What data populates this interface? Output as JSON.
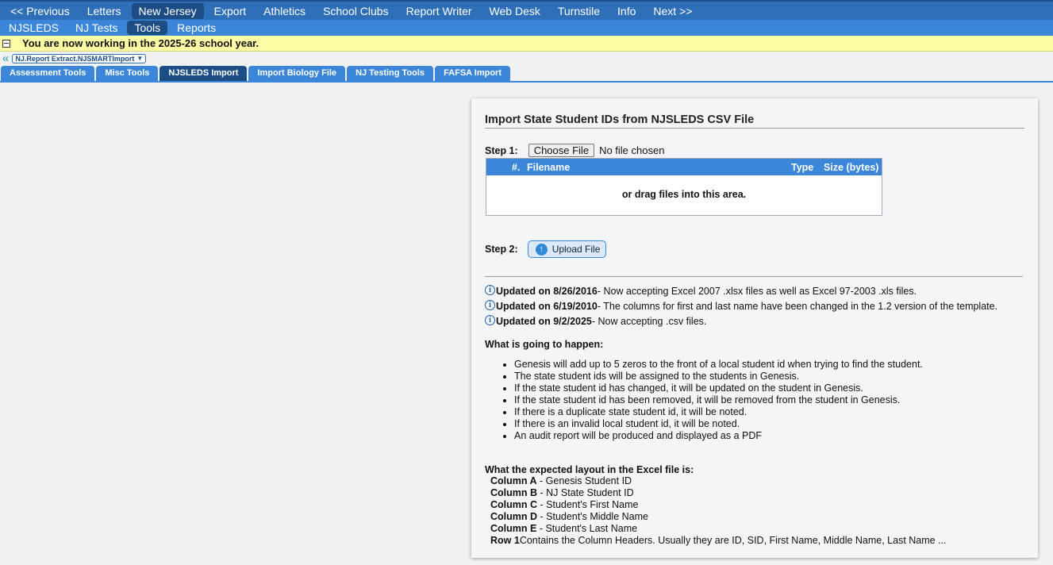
{
  "nav": {
    "items": [
      {
        "label": "<< Previous",
        "active": false
      },
      {
        "label": "Letters",
        "active": false
      },
      {
        "label": "New Jersey",
        "active": true
      },
      {
        "label": "Export",
        "active": false
      },
      {
        "label": "Athletics",
        "active": false
      },
      {
        "label": "School Clubs",
        "active": false
      },
      {
        "label": "Report Writer",
        "active": false
      },
      {
        "label": "Web Desk",
        "active": false
      },
      {
        "label": "Turnstile",
        "active": false
      },
      {
        "label": "Info",
        "active": false
      },
      {
        "label": "Next >>",
        "active": false
      }
    ]
  },
  "subnav": {
    "items": [
      {
        "label": "NJSLEDS",
        "active": false
      },
      {
        "label": "NJ Tests",
        "active": false
      },
      {
        "label": "Tools",
        "active": true
      },
      {
        "label": "Reports",
        "active": false
      }
    ]
  },
  "banner": {
    "text": "You are now working in the 2025-26 school year."
  },
  "breadcrumb": {
    "select_value": "NJ.Report Extract.NJSMARTImport"
  },
  "tabs": [
    {
      "label": "Assessment Tools",
      "active": false
    },
    {
      "label": "Misc Tools",
      "active": false
    },
    {
      "label": "NJSLEDS Import",
      "active": true
    },
    {
      "label": "Import Biology File",
      "active": false
    },
    {
      "label": "NJ Testing Tools",
      "active": false
    },
    {
      "label": "FAFSA Import",
      "active": false
    }
  ],
  "panel": {
    "title": "Import State Student IDs from NJSLEDS CSV File",
    "step1_label": "Step 1:",
    "choose_file_label": "Choose File",
    "no_file_text": "No file chosen",
    "file_table": {
      "col_num": "#.",
      "col_filename": "Filename",
      "col_type": "Type",
      "col_size": "Size (bytes)",
      "drag_text": "or drag files into this area."
    },
    "step2_label": "Step 2:",
    "upload_label": "Upload File",
    "updates": [
      {
        "date": "Updated on 8/26/2016",
        "text": " - Now accepting Excel 2007 .xlsx files as well as Excel 97-2003 .xls files."
      },
      {
        "date": "Updated on 6/19/2010",
        "text": " - The columns for first and last name have been changed in the 1.2 version of the template."
      },
      {
        "date": "Updated on 9/2/2025",
        "text": " - Now accepting .csv files."
      }
    ],
    "what_title": "What is going to happen:",
    "bullets": [
      "Genesis will add up to 5 zeros to the front of a local student id when trying to find the student.",
      "The state student ids will be assigned to the students in Genesis.",
      "If the state student id has changed, it will be updated on the student in Genesis.",
      "If the state student id has been removed, it will be removed from the student in Genesis.",
      "If there is a duplicate state student id, it will be noted.",
      "If there is an invalid local student id, it will be noted.",
      "An audit report will be produced and displayed as a PDF"
    ],
    "layout_title": "What the expected layout in the Excel file is:",
    "columns": [
      {
        "name": "Column A",
        "desc": " - Genesis Student ID"
      },
      {
        "name": "Column B",
        "desc": " - NJ State Student ID"
      },
      {
        "name": "Column C",
        "desc": " - Student's First Name"
      },
      {
        "name": "Column D",
        "desc": " - Student's Middle Name"
      },
      {
        "name": "Column E",
        "desc": " - Student's Last Name"
      },
      {
        "name": "Row 1",
        "desc": "Contains the Column Headers. Usually they are ID, SID, First Name, Middle Name, Last Name ..."
      }
    ]
  },
  "colors": {
    "nav_bg": "#2e6fb8",
    "subnav_bg": "#3b86d8",
    "active_bg": "#1c4d85",
    "banner_bg": "#fffca6"
  }
}
